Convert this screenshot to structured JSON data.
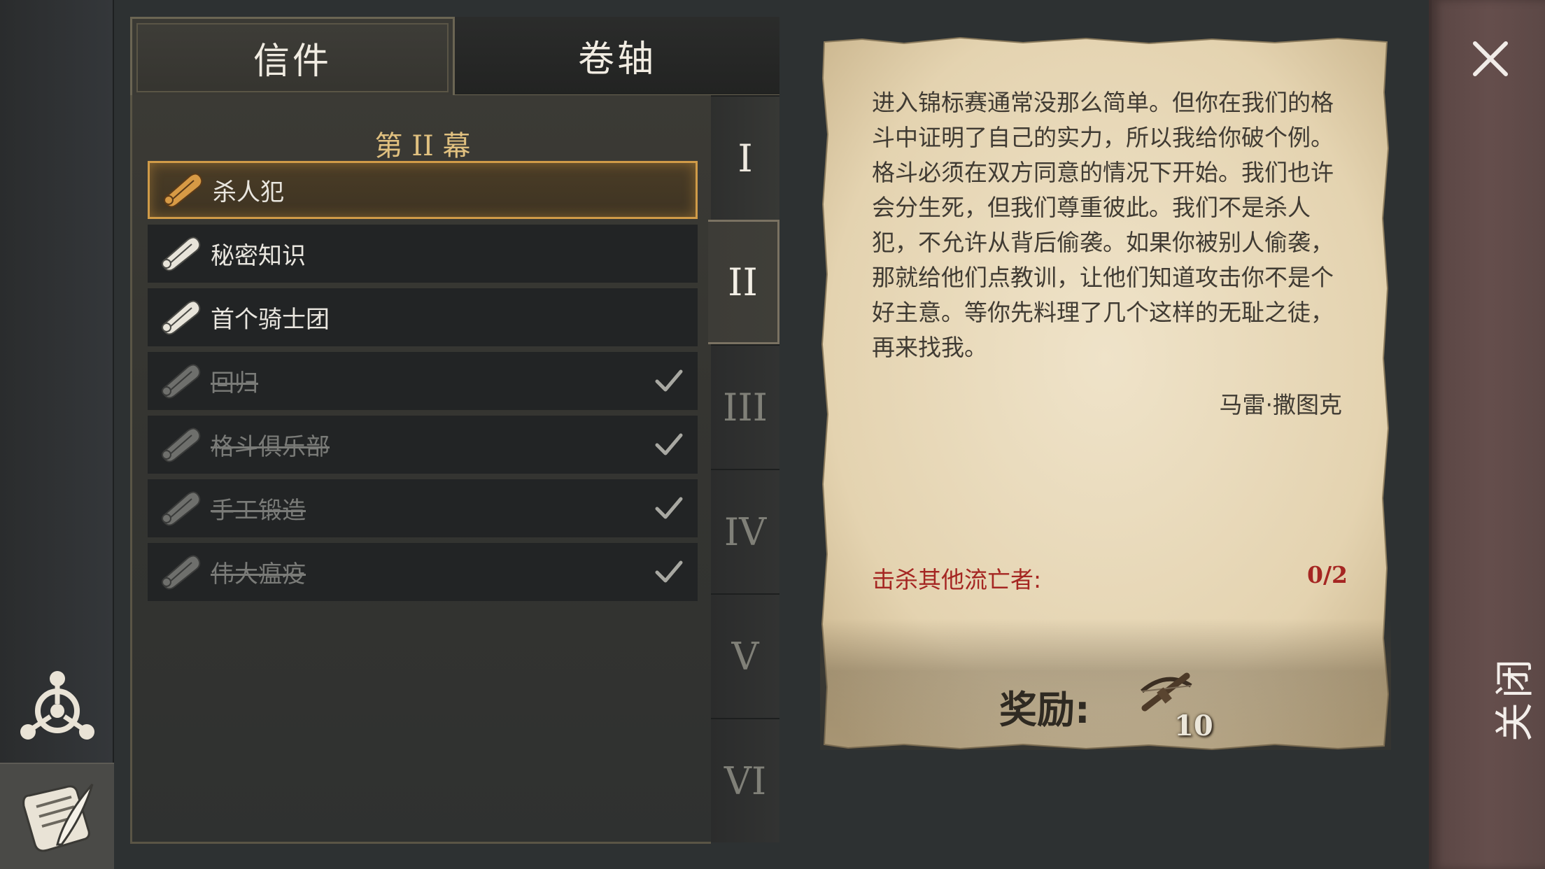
{
  "tabs": [
    {
      "label": "信件",
      "active": true
    },
    {
      "label": "卷轴",
      "active": false
    }
  ],
  "act_title": "第 II 幕",
  "quests": [
    {
      "label": "杀人犯",
      "selected": true,
      "done": false
    },
    {
      "label": "秘密知识",
      "selected": false,
      "done": false
    },
    {
      "label": "首个骑士团",
      "selected": false,
      "done": false
    },
    {
      "label": "回归",
      "selected": false,
      "done": true
    },
    {
      "label": "格斗俱乐部",
      "selected": false,
      "done": true
    },
    {
      "label": "手工锻造",
      "selected": false,
      "done": true
    },
    {
      "label": "伟大瘟疫",
      "selected": false,
      "done": true
    }
  ],
  "acts": [
    "I",
    "II",
    "III",
    "IV",
    "V",
    "VI"
  ],
  "current_act": "II",
  "letter": {
    "body": "进入锦标赛通常没那么简单。但你在我们的格斗中证明了自己的实力，所以我给你破个例。格斗必须在双方同意的情况下开始。我们也许会分生死，但我们尊重彼此。我们不是杀人犯，不允许从背后偷袭。如果你被别人偷袭，那就给他们点教训，让他们知道攻击你不是个好主意。等你先料理了几个这样的无耻之徒，再来找我。",
    "signature": "马雷·撒图克",
    "objective_label": "击杀其他流亡者:",
    "objective_count": "0/2",
    "reward_label": "奖励:",
    "reward_amount": "10",
    "reward_icon": "crossbow-icon"
  },
  "close_label": "关闭",
  "colors": {
    "accent_gold": "#d09b48",
    "objective_red": "#a52622",
    "close_rail": "#654e4c"
  }
}
